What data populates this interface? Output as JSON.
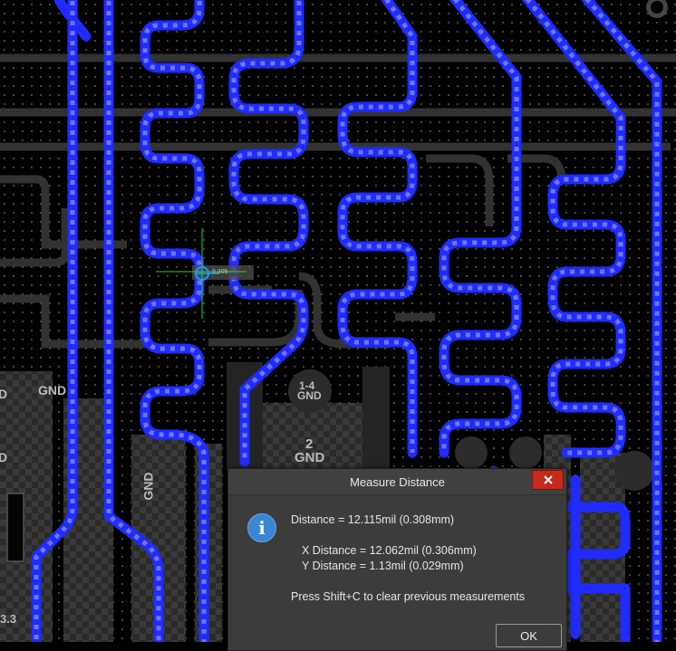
{
  "canvas": {
    "labels": {
      "gnd_left": "GND",
      "pad_14": "1-4",
      "pad_14_net": "GND",
      "pad_2": "2",
      "pad_2_net": "GND",
      "gnd_vertical": "GND",
      "edge_left_top": "D",
      "edge_left_mid": "D",
      "edge_left_bottom": "3.3"
    },
    "cursor_label": "0.305"
  },
  "dialog": {
    "title": "Measure Distance",
    "distance": "Distance = 12.115mil (0.308mm)",
    "x_distance": "X Distance = 12.062mil (0.306mm)",
    "y_distance": "Y Distance = 1.13mil (0.029mm)",
    "hint": "Press Shift+C to clear previous measurements",
    "ok_label": "OK",
    "icon": "info-icon",
    "close_icon": "close-icon"
  },
  "colors": {
    "trace_blue": "#1f2bff",
    "grey_copper": "#3a3a3a",
    "close_red": "#c42b1c",
    "crosshair_green": "#22dd22"
  }
}
